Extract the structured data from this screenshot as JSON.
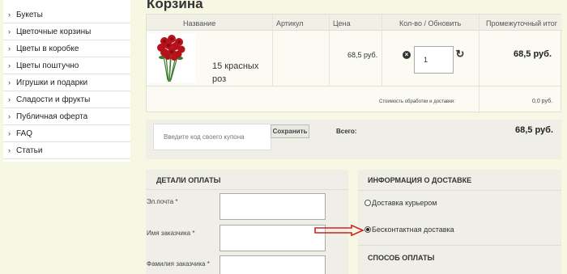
{
  "sidebar": {
    "items": [
      {
        "label": "Букеты"
      },
      {
        "label": "Цветочные корзины"
      },
      {
        "label": "Цветы в коробке"
      },
      {
        "label": "Цветы поштучно"
      },
      {
        "label": "Игрушки и подарки"
      },
      {
        "label": "Сладости и фрукты"
      },
      {
        "label": "Публичная оферта"
      },
      {
        "label": "FAQ"
      },
      {
        "label": "Статьи"
      }
    ]
  },
  "page": {
    "title": "Корзина"
  },
  "cart": {
    "headers": {
      "name": "Название",
      "article": "Артикул",
      "price": "Цена",
      "qty": "Кол-во / Обновить",
      "subtotal": "Промежуточный итог"
    },
    "item": {
      "name": "15 красных роз",
      "price": "68,5 руб.",
      "qty": "1",
      "subtotal": "68,5 руб."
    },
    "fee_label": "Стоимость обработки и доставки:",
    "fee_value": "0,0 руб."
  },
  "coupon": {
    "placeholder": "Введите код своего купона",
    "save_label": "Сохранить"
  },
  "total": {
    "label": "Всего:",
    "value": "68,5 руб."
  },
  "billing": {
    "title": "ДЕТАЛИ ОПЛАТЫ",
    "fields": [
      {
        "label": "Эл.почта *"
      },
      {
        "label": "Имя заказчика *"
      },
      {
        "label": "Фамилия заказчика *"
      }
    ]
  },
  "delivery": {
    "title": "ИНФОРМАЦИЯ О ДОСТАВКЕ",
    "options": [
      {
        "label": "Доставка курьером",
        "selected": false
      },
      {
        "label": "Бесконтактная доставка",
        "selected": true
      }
    ]
  },
  "payment": {
    "title": "СПОСОБ ОПЛАТЫ"
  },
  "colors": {
    "arrow": "#d42020",
    "rose": "#b5121b",
    "stem": "#3b7a2a"
  }
}
